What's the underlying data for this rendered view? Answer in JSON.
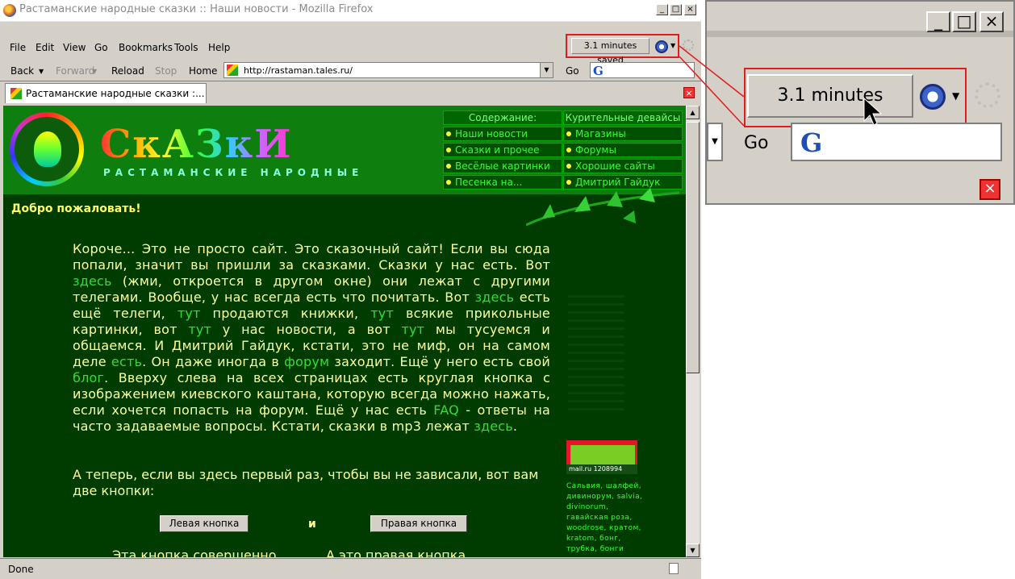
{
  "window": {
    "title": "Растаманские народные сказки :: Наши новости - Mozilla Firefox",
    "min_glyph": "_",
    "max_glyph": "□",
    "close_glyph": "×"
  },
  "menu": [
    "File",
    "Edit",
    "View",
    "Go",
    "Bookmarks",
    "Tools",
    "Help"
  ],
  "toolbar": {
    "back": "Back",
    "forward": "Forward",
    "reload": "Reload",
    "stop": "Stop",
    "home": "Home",
    "url": "http://rastaman.tales.ru/",
    "go": "Go",
    "saved": "3.1 minutes saved",
    "search_logo": "G"
  },
  "tab": {
    "label": "Растаманские народные сказки :..."
  },
  "site": {
    "title": "СкАЗкИ",
    "subtitle": "РАСТАМАНСКИЕ НАРОДНЫЕ",
    "nav_left": {
      "head": "Содержание:",
      "items": [
        "Наши новости",
        "Сказки и прочее",
        "Весёлые картинки",
        "Песенка на..."
      ]
    },
    "nav_right": {
      "head": "Курительные девайсы",
      "items": [
        "Магазины",
        "Форумы",
        "Хорошие сайты",
        "Дмитрий Гайдук"
      ]
    },
    "welcome": "Добро пожаловать!",
    "paragraph": [
      {
        "t": "Короче... Это не просто сайт. Это сказочный сайт! Если вы сюда попали, значит вы пришли за сказками. Сказки у нас есть. Вот "
      },
      {
        "l": "здесь"
      },
      {
        "t": " (жми, откроется в другом окне) они лежат с другими телегами. Вообще, у нас всегда есть что почитать. Вот "
      },
      {
        "l": "здесь"
      },
      {
        "t": " есть ещё телеги, "
      },
      {
        "l": "тут"
      },
      {
        "t": " продаются книжки, "
      },
      {
        "l": "тут"
      },
      {
        "t": " всякие прикольные картинки, вот "
      },
      {
        "l": "тут"
      },
      {
        "t": " у нас новости, а вот "
      },
      {
        "l": "тут"
      },
      {
        "t": " мы тусуемся и общаемся. И Дмитрий Гайдук, кстати, это не миф, он на самом деле "
      },
      {
        "l": "есть"
      },
      {
        "t": ". Он даже иногда в "
      },
      {
        "l": "форум"
      },
      {
        "t": " заходит. Ещё у него есть свой "
      },
      {
        "l": "блог"
      },
      {
        "t": ". Вверху слева на всех страницах есть круглая кнопка с изображением киевского каштана, которую всегда можно нажать, если хочется попасть на форум. Ещё у нас есть "
      },
      {
        "l": "FAQ"
      },
      {
        "t": " - ответы на часто задаваемые вопросы. Кстати, сказки в mp3 лежат "
      },
      {
        "l": "здесь"
      },
      {
        "t": "."
      }
    ],
    "para2": "А теперь, если вы здесь первый раз, чтобы вы не зависали, вот вам две кнопки:",
    "left_button": "Левая кнопка",
    "and": "и",
    "right_button": "Правая кнопка",
    "bottom_left": "Эта кнопка совершенно",
    "bottom_right": "А это правая кнопка",
    "counter": "mail.ru   1208994",
    "side_text": "Сальвия, шалфей, дивинорум, salvia, divinorum, гавайская роза, woodrose, кратом, kratom, бонг, трубка, бонги"
  },
  "status": {
    "text": "Done"
  },
  "zoom": {
    "saved": "3.1 minutes saved",
    "go": "Go",
    "search_logo": "G"
  },
  "colors": {
    "highlight": "#e01d1d",
    "page_bg": "#003b00",
    "header_bg": "#0e7e0e",
    "text": "#ffff99",
    "link": "#33dd33"
  }
}
